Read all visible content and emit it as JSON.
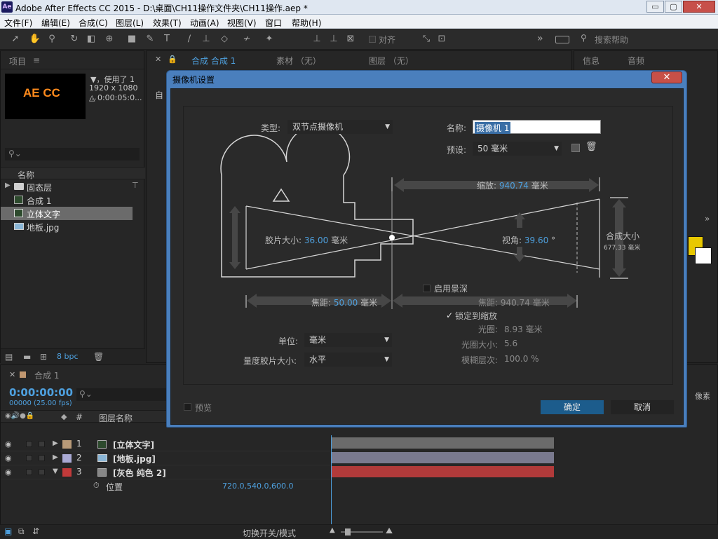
{
  "window": {
    "app_icon": "Ae",
    "title": "Adobe After Effects CC 2015 - D:\\桌面\\CH11操作文件夹\\CH11操作.aep *",
    "minimize": "▭",
    "maximize": "▢",
    "close": "✕"
  },
  "menu": [
    "文件(F)",
    "编辑(E)",
    "合成(C)",
    "图层(L)",
    "效果(T)",
    "动画(A)",
    "视图(V)",
    "窗口",
    "帮助(H)"
  ],
  "toolbar": {
    "snap_label": "对齐",
    "more": "»",
    "search_placeholder": "搜索帮助"
  },
  "project": {
    "tab": "项目",
    "tab_menu": "≡",
    "thumb_text": "AE CC",
    "info_line1": "▼，使用了 1",
    "info_line2": "1920 x 1080 ...",
    "info_line3": "△ 0:00:05:0...",
    "search_placeholder": "",
    "col_name": "名称",
    "items": [
      {
        "name": "固态层",
        "type": "folder"
      },
      {
        "name": "合成 1",
        "type": "comp"
      },
      {
        "name": "立体文字",
        "type": "comp"
      },
      {
        "name": "地板.jpg",
        "type": "image"
      }
    ],
    "bpc": "8 bpc"
  },
  "comp_panel": {
    "tab_comp": "合成 合成 1",
    "tab_footage": "素材 （无）",
    "tab_layer": "图层 （无）",
    "partial_label": "自"
  },
  "right_panel": {
    "tab_info": "信息",
    "tab_audio": "音频"
  },
  "timeline": {
    "tab": "合成 1",
    "timecode": "0:00:00:00",
    "frames": "00000 (25.00 fps)",
    "col_layer_name": "图层名称",
    "col_hash": "#",
    "layers": [
      {
        "num": "1",
        "name": "[立体文字]",
        "color": "#b89a78",
        "bar": "#6b6b6b"
      },
      {
        "num": "2",
        "name": "[地板.jpg]",
        "color": "#a9a9d4",
        "bar": "#7a7a8f"
      },
      {
        "num": "3",
        "name": "[灰色 纯色 2]",
        "color": "#c23a3a",
        "bar": "#b13a3a"
      }
    ],
    "prop_name": "位置",
    "prop_value": "720.0,540.0,600.0",
    "footer_toggle": "切换开关/模式",
    "partial_pixels": "像素"
  },
  "dialog": {
    "title": "摄像机设置",
    "close": "✕",
    "type_label": "类型:",
    "type_value": "双节点摄像机",
    "name_label": "名称:",
    "name_value": "摄像机 1",
    "preset_label": "预设:",
    "preset_value": "50 毫米",
    "zoom_label": "缩放:",
    "zoom_value": "940.74",
    "zoom_unit": "毫米",
    "film_label": "胶片大小:",
    "film_value": "36.00",
    "film_unit": "毫米",
    "angle_label": "视角:",
    "angle_value": "39.60",
    "angle_unit": "°",
    "comp_size_label": "合成大小",
    "comp_size_value": "677.33 毫米",
    "dof_label": "启用景深",
    "focal_label": "焦距:",
    "focal_value": "50.00",
    "focal_unit": "毫米",
    "focus_dist_label": "焦距:",
    "focus_dist_value": "940.74",
    "focus_dist_unit": "毫米",
    "lock_label": "锁定到缩放",
    "aperture_label": "光圈:",
    "aperture_value": "8.93 毫米",
    "fstop_label": "光圈大小:",
    "fstop_value": "5.6",
    "blur_label": "模糊层次:",
    "blur_value": "100.0 %",
    "units_label": "单位:",
    "units_value": "毫米",
    "measure_label": "量度胶片大小:",
    "measure_value": "水平",
    "preview_label": "预览",
    "ok": "确定",
    "cancel": "取消",
    "accent": "#1c5c8c"
  }
}
